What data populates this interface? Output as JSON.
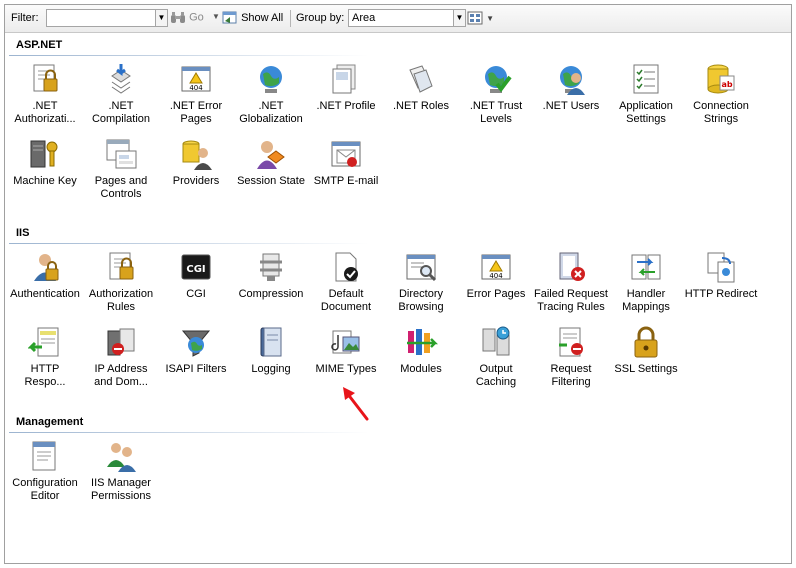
{
  "toolbar": {
    "filter_label": "Filter:",
    "filter_value": "",
    "go_label": "Go",
    "show_all_label": "Show All",
    "group_by_label": "Group by:",
    "group_by_value": "Area"
  },
  "groups": [
    {
      "title": "ASP.NET",
      "items": [
        {
          "line1": ".NET",
          "line2": "Authorizati...",
          "icon": "net-authorization-icon"
        },
        {
          "line1": ".NET",
          "line2": "Compilation",
          "icon": "net-compilation-icon"
        },
        {
          "line1": ".NET Error",
          "line2": "Pages",
          "icon": "net-error-pages-icon"
        },
        {
          "line1": ".NET",
          "line2": "Globalization",
          "icon": "net-globalization-icon"
        },
        {
          "line1": ".NET Profile",
          "line2": "",
          "icon": "net-profile-icon"
        },
        {
          "line1": ".NET Roles",
          "line2": "",
          "icon": "net-roles-icon"
        },
        {
          "line1": ".NET Trust",
          "line2": "Levels",
          "icon": "net-trust-levels-icon"
        },
        {
          "line1": ".NET Users",
          "line2": "",
          "icon": "net-users-icon"
        },
        {
          "line1": "Application",
          "line2": "Settings",
          "icon": "application-settings-icon"
        },
        {
          "line1": "Connection",
          "line2": "Strings",
          "icon": "connection-strings-icon"
        },
        {
          "line1": "Machine Key",
          "line2": "",
          "icon": "machine-key-icon"
        },
        {
          "line1": "Pages and",
          "line2": "Controls",
          "icon": "pages-and-controls-icon"
        },
        {
          "line1": "Providers",
          "line2": "",
          "icon": "providers-icon"
        },
        {
          "line1": "Session State",
          "line2": "",
          "icon": "session-state-icon"
        },
        {
          "line1": "SMTP E-mail",
          "line2": "",
          "icon": "smtp-email-icon"
        }
      ]
    },
    {
      "title": "IIS",
      "items": [
        {
          "line1": "Authentication",
          "line2": "",
          "icon": "authentication-icon"
        },
        {
          "line1": "Authorization",
          "line2": "Rules",
          "icon": "authorization-rules-icon"
        },
        {
          "line1": "CGI",
          "line2": "",
          "icon": "cgi-icon"
        },
        {
          "line1": "Compression",
          "line2": "",
          "icon": "compression-icon"
        },
        {
          "line1": "Default",
          "line2": "Document",
          "icon": "default-document-icon"
        },
        {
          "line1": "Directory",
          "line2": "Browsing",
          "icon": "directory-browsing-icon"
        },
        {
          "line1": "Error Pages",
          "line2": "",
          "icon": "error-pages-icon"
        },
        {
          "line1": "Failed Request",
          "line2": "Tracing Rules",
          "icon": "failed-request-tracing-icon"
        },
        {
          "line1": "Handler",
          "line2": "Mappings",
          "icon": "handler-mappings-icon"
        },
        {
          "line1": "HTTP Redirect",
          "line2": "",
          "icon": "http-redirect-icon"
        },
        {
          "line1": "HTTP",
          "line2": "Respo...",
          "icon": "http-response-headers-icon"
        },
        {
          "line1": "IP Address",
          "line2": "and Dom...",
          "icon": "ip-address-domain-icon"
        },
        {
          "line1": "ISAPI Filters",
          "line2": "",
          "icon": "isapi-filters-icon"
        },
        {
          "line1": "Logging",
          "line2": "",
          "icon": "logging-icon"
        },
        {
          "line1": "MIME Types",
          "line2": "",
          "icon": "mime-types-icon"
        },
        {
          "line1": "Modules",
          "line2": "",
          "icon": "modules-icon"
        },
        {
          "line1": "Output",
          "line2": "Caching",
          "icon": "output-caching-icon"
        },
        {
          "line1": "Request",
          "line2": "Filtering",
          "icon": "request-filtering-icon"
        },
        {
          "line1": "SSL Settings",
          "line2": "",
          "icon": "ssl-settings-icon"
        }
      ]
    },
    {
      "title": "Management",
      "items": [
        {
          "line1": "Configuration",
          "line2": "Editor",
          "icon": "configuration-editor-icon"
        },
        {
          "line1": "IIS Manager",
          "line2": "Permissions",
          "icon": "iis-manager-permissions-icon"
        }
      ]
    }
  ],
  "colors": {
    "accent_line": "#9cb4d0",
    "arrow": "#e8141a"
  }
}
